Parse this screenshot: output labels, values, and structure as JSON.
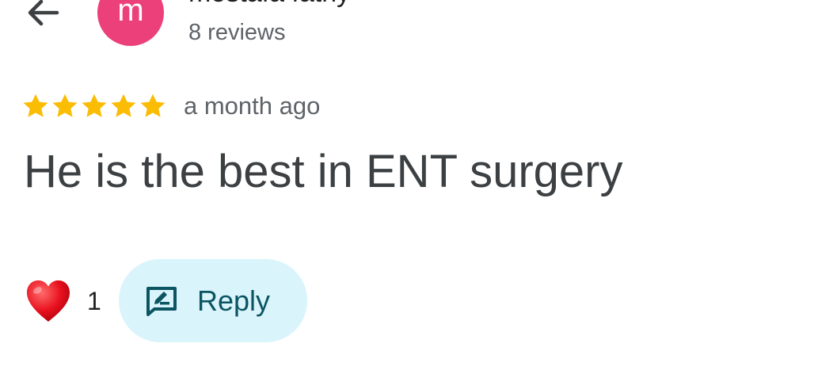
{
  "header": {
    "back_icon": "arrow-left-icon",
    "avatar_letter": "m",
    "avatar_color": "#ec407a",
    "reviewer_name": "mostafa fathy",
    "review_count": "8 reviews"
  },
  "review": {
    "rating": 5,
    "rating_max": 5,
    "star_color": "#fbbc04",
    "time_ago": "a month ago",
    "text": "He is the best in ENT surgery"
  },
  "actions": {
    "like_icon": "heart-icon",
    "like_count": "1",
    "reply_icon": "rate-review-icon",
    "reply_label": "Reply",
    "reply_bg_color": "#daf4fb",
    "reply_text_color": "#0b5563"
  }
}
